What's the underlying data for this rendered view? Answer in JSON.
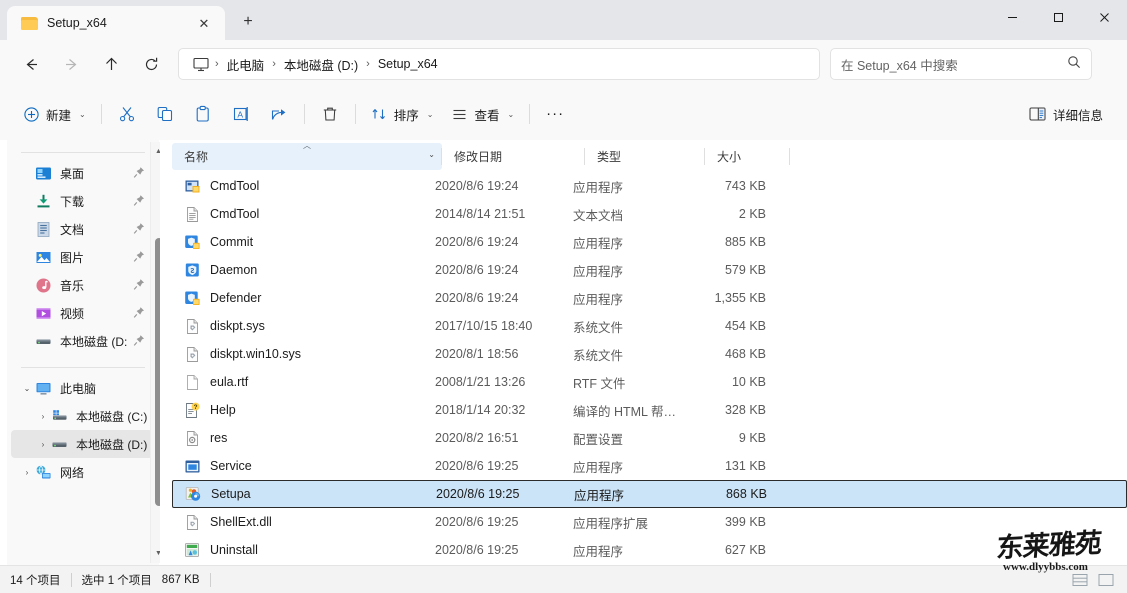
{
  "window": {
    "tab_title": "Setup_x64",
    "new_tab_label": "+",
    "close_tab_label": "✕",
    "minimize_label": "—",
    "maximize_label": "☐",
    "close_label": "✕"
  },
  "nav": {
    "back": "←",
    "forward": "→",
    "up": "↑",
    "refresh": "⟳",
    "breadcrumb": [
      {
        "label": "此电脑",
        "icon": "this-pc-icon"
      },
      {
        "label": "本地磁盘 (D:)",
        "icon": ""
      },
      {
        "label": "Setup_x64",
        "icon": ""
      }
    ],
    "separator": "›"
  },
  "search": {
    "placeholder": "在 Setup_x64 中搜索",
    "icon": "search-icon"
  },
  "toolbar": {
    "new_label": "新建",
    "cut_label": "剪切",
    "copy_label": "复制",
    "paste_label": "粘贴",
    "rename_label": "重命名",
    "share_label": "共享",
    "delete_label": "删除",
    "sort_label": "排序",
    "view_label": "查看",
    "more_label": "···",
    "details_label": "详细信息",
    "chevron": "⌄"
  },
  "sidebar": {
    "quick_items": [
      {
        "label": "桌面",
        "icon": "desktop-icon",
        "pinned": true
      },
      {
        "label": "下载",
        "icon": "downloads-icon",
        "pinned": true
      },
      {
        "label": "文档",
        "icon": "documents-icon",
        "pinned": true
      },
      {
        "label": "图片",
        "icon": "pictures-icon",
        "pinned": true
      },
      {
        "label": "音乐",
        "icon": "music-icon",
        "pinned": true
      },
      {
        "label": "视频",
        "icon": "videos-icon",
        "pinned": true
      },
      {
        "label": "本地磁盘 (D:",
        "icon": "drive-icon",
        "pinned": true
      }
    ],
    "tree_items": [
      {
        "label": "此电脑",
        "icon": "this-pc-icon",
        "caret": "⌄",
        "indent": 0,
        "selected": false
      },
      {
        "label": "本地磁盘 (C:)",
        "icon": "windows-drive-icon",
        "caret": "›",
        "indent": 1,
        "selected": false
      },
      {
        "label": "本地磁盘 (D:)",
        "icon": "drive-icon",
        "caret": "›",
        "indent": 1,
        "selected": true
      },
      {
        "label": "网络",
        "icon": "network-icon",
        "caret": "›",
        "indent": 0,
        "selected": false
      }
    ]
  },
  "columns": {
    "name": "名称",
    "date": "修改日期",
    "type": "类型",
    "size": "大小",
    "sort_indicator": "︿",
    "chevron": "⌄"
  },
  "files": [
    {
      "name": "CmdTool",
      "date": "2020/8/6 19:24",
      "type": "应用程序",
      "size": "743 KB",
      "icon": "exe-cmd-icon",
      "selected": false
    },
    {
      "name": "CmdTool",
      "date": "2014/8/14 21:51",
      "type": "文本文档",
      "size": "2 KB",
      "icon": "text-icon",
      "selected": false
    },
    {
      "name": "Commit",
      "date": "2020/8/6 19:24",
      "type": "应用程序",
      "size": "885 KB",
      "icon": "exe-shield-icon",
      "selected": false
    },
    {
      "name": "Daemon",
      "date": "2020/8/6 19:24",
      "type": "应用程序",
      "size": "579 KB",
      "icon": "exe-blue-icon",
      "selected": false
    },
    {
      "name": "Defender",
      "date": "2020/8/6 19:24",
      "type": "应用程序",
      "size": "1,355 KB",
      "icon": "exe-shield-icon",
      "selected": false
    },
    {
      "name": "diskpt.sys",
      "date": "2017/10/15 18:40",
      "type": "系统文件",
      "size": "454 KB",
      "icon": "sys-icon",
      "selected": false
    },
    {
      "name": "diskpt.win10.sys",
      "date": "2020/8/1 18:56",
      "type": "系统文件",
      "size": "468 KB",
      "icon": "sys-icon",
      "selected": false
    },
    {
      "name": "eula.rtf",
      "date": "2008/1/21 13:26",
      "type": "RTF 文件",
      "size": "10 KB",
      "icon": "blank-doc-icon",
      "selected": false
    },
    {
      "name": "Help",
      "date": "2018/1/14 20:32",
      "type": "编译的 HTML 帮…",
      "size": "328 KB",
      "icon": "chm-help-icon",
      "selected": false
    },
    {
      "name": "res",
      "date": "2020/8/2 16:51",
      "type": "配置设置",
      "size": "9 KB",
      "icon": "config-icon",
      "selected": false
    },
    {
      "name": "Service",
      "date": "2020/8/6 19:25",
      "type": "应用程序",
      "size": "131 KB",
      "icon": "exe-window-icon",
      "selected": false
    },
    {
      "name": "Setupa",
      "date": "2020/8/6 19:25",
      "type": "应用程序",
      "size": "868 KB",
      "icon": "setup-icon",
      "selected": true
    },
    {
      "name": "ShellExt.dll",
      "date": "2020/8/6 19:25",
      "type": "应用程序扩展",
      "size": "399 KB",
      "icon": "dll-icon",
      "selected": false
    },
    {
      "name": "Uninstall",
      "date": "2020/8/6 19:25",
      "type": "应用程序",
      "size": "627 KB",
      "icon": "uninstall-icon",
      "selected": false
    }
  ],
  "status": {
    "item_count": "14 个项目",
    "selection": "选中 1 个项目",
    "selection_size": "867 KB"
  },
  "watermark": {
    "chinese": "东莱雅苑",
    "url": "www.dlyybbs.com"
  }
}
